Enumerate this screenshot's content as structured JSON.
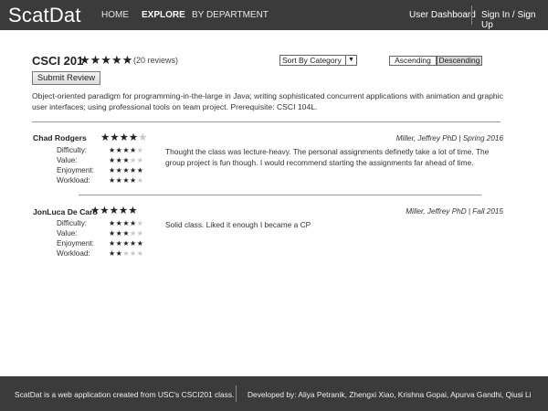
{
  "nav": {
    "brand": "ScatDat",
    "home": "HOME",
    "explore": "EXPLORE",
    "by_department": "BY DEPARTMENT",
    "user_dashboard": "User Dashboard",
    "sign_in": "Sign In / Sign Up"
  },
  "course": {
    "title": "CSCI 201",
    "rating": 5,
    "stars": "★★★★★",
    "review_count": "(20 reviews)",
    "submit_label": "Submit Review",
    "sort_selected": "Sort By Category",
    "sort_arrow": "▼",
    "order_asc": "Ascending",
    "order_desc": "Descending",
    "order_selected": "Descending",
    "description": "Object-oriented paradigm for programming-in-the-large in Java; writing sophisticated concurrent applications with animation and graphic user interfaces; using professional tools on team project. Prerequisite: CSCI 104L."
  },
  "metric_labels": {
    "difficulty": "Difficulty:",
    "value": "Value:",
    "enjoyment": "Enjoyment:",
    "workload": "Workload:"
  },
  "reviews": [
    {
      "name": "Chad Rodgers",
      "rating": 4,
      "stars_on": "★★★★",
      "stars_off": "★",
      "prof_term": "Miller, Jeffrey PhD | Spring 2016",
      "difficulty": 4,
      "difficulty_on": "★★★★",
      "difficulty_off": "★",
      "value": 3,
      "value_on": "★★★",
      "value_off": "★★",
      "enjoyment": 5,
      "enjoyment_on": "★★★★★",
      "enjoyment_off": "",
      "workload": 4,
      "workload_on": "★★★★",
      "workload_off": "★",
      "text": "Thought the class was lecture-heavy. The personal assignments definetly take a lot of time. The group project is fun though. I would recommend starting the assignments far ahead of time."
    },
    {
      "name": "JonLuca De Caro",
      "rating": 5,
      "stars_on": "★★★★★",
      "stars_off": "",
      "prof_term": "Miller, Jeffrey PhD | Fall 2015",
      "difficulty": 4,
      "difficulty_on": "★★★★",
      "difficulty_off": "★",
      "value": 3,
      "value_on": "★★★",
      "value_off": "★★",
      "enjoyment": 5,
      "enjoyment_on": "★★★★★",
      "enjoyment_off": "",
      "workload": 2,
      "workload_on": "★★",
      "workload_off": "★★★",
      "text": "Solid class. Liked it enough I became a CP"
    }
  ],
  "footer": {
    "left": "ScatDat is a web application created from USC's CSCI201 class.",
    "right": "Developed by: Aliya Petranik, Zhengxi Xiao, Krishna Gopai, Apurva Gandhi, Qiusi Li"
  },
  "colors": {
    "bar_bg": "#3b3b3b",
    "star_on": "#222222",
    "star_off": "#c8c8c8",
    "selected_order_bg": "#d6d6d6"
  }
}
